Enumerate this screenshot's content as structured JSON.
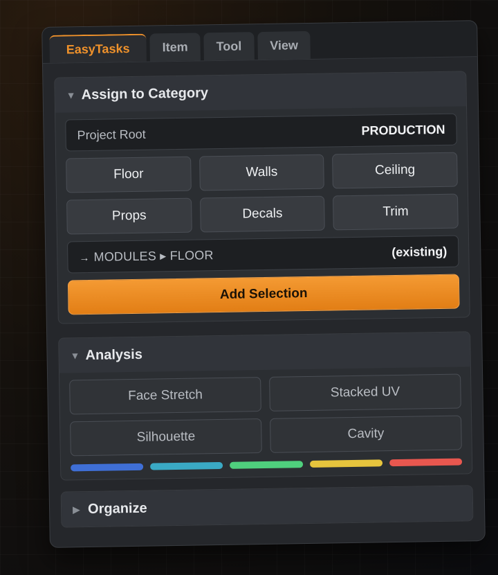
{
  "tabs": [
    {
      "label": "EasyTasks",
      "active": true
    },
    {
      "label": "Item",
      "active": false
    },
    {
      "label": "Tool",
      "active": false
    },
    {
      "label": "View",
      "active": false
    }
  ],
  "assign": {
    "title": "Assign to Category",
    "chevron": "▼",
    "project_label": "Project Root",
    "project_value": "PRODUCTION",
    "categories": [
      "Floor",
      "Walls",
      "Ceiling",
      "Props",
      "Decals",
      "Trim"
    ],
    "path_arrow": "→",
    "path": "MODULES ▸ FLOOR",
    "path_status": "(existing)",
    "add_button": "Add Selection"
  },
  "analysis": {
    "title": "Analysis",
    "chevron": "▼",
    "buttons": [
      "Face Stretch",
      "Stacked UV",
      "Silhouette",
      "Cavity"
    ],
    "colors": [
      "#3f6fd6",
      "#3aa9c4",
      "#4fcf7d",
      "#e6c43d",
      "#e8574f"
    ]
  },
  "organize": {
    "title": "Organize",
    "chevron": "▶"
  }
}
